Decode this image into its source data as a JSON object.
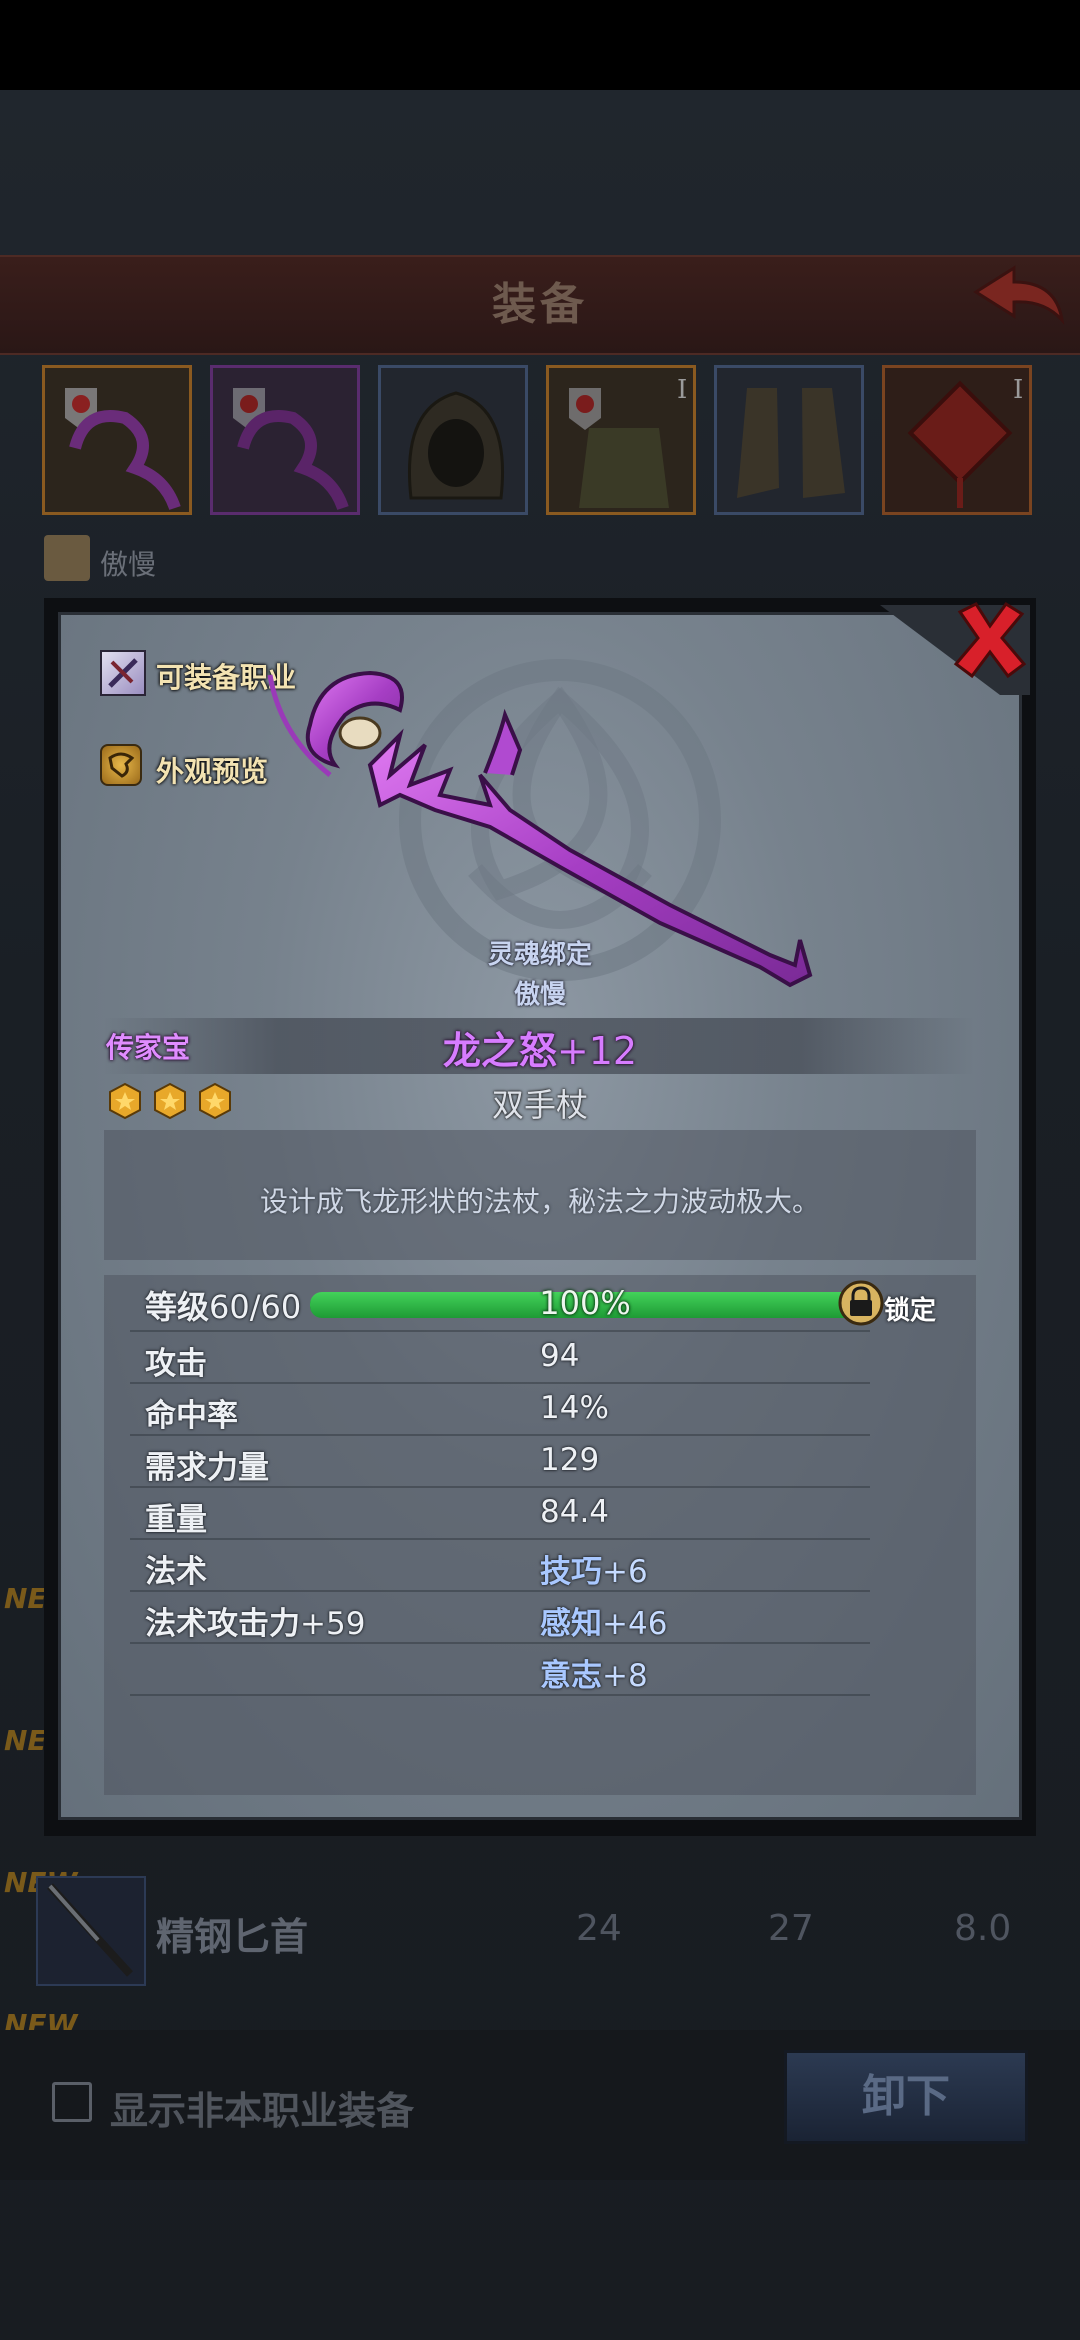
{
  "background_screen": {
    "title": "装备",
    "owner_name": "傲慢",
    "equipment_slots": [
      {
        "name": "staff",
        "quality": "gold",
        "tier": ""
      },
      {
        "name": "staff",
        "quality": "purple",
        "tier": ""
      },
      {
        "name": "hood",
        "quality": "blue",
        "tier": ""
      },
      {
        "name": "armor",
        "quality": "gold",
        "tier": "I"
      },
      {
        "name": "boots",
        "quality": "blue",
        "tier": ""
      },
      {
        "name": "charm",
        "quality": "orange",
        "tier": "I"
      }
    ],
    "new_tags": [
      "NEW",
      "NEW",
      "NEW",
      "NEW"
    ],
    "list_item": {
      "name": "精钢匕首",
      "stat1": "24",
      "stat2": "27",
      "stat3": "8.0"
    },
    "show_other_class_label": "显示非本职业装备",
    "unequip_label": "卸下"
  },
  "popup": {
    "job_button_label": "可装备职业",
    "preview_button_label": "外观预览",
    "soulbound_label": "灵魂绑定",
    "bound_owner": "傲慢",
    "rarity": "传家宝",
    "item_name": "龙之怒",
    "enhance": "+12",
    "stars": 3,
    "item_type": "双手杖",
    "description": "设计成飞龙形状的法杖，秘法之力波动极大。",
    "level_label": "等级",
    "level_value": "60/60",
    "progress_text": "100%",
    "progress": 1.0,
    "lock_label": "锁定",
    "stats": [
      {
        "label": "攻击",
        "value": "94"
      },
      {
        "label": "命中率",
        "value": "14%"
      },
      {
        "label": "需求力量",
        "value": "129"
      },
      {
        "label": "重量",
        "value": "84.4"
      }
    ],
    "magic_label": "法术",
    "magic_attack_label": "法术攻击力",
    "magic_attack_value": "+59",
    "bonus_stats": [
      {
        "label": "技巧",
        "value": "+6"
      },
      {
        "label": "感知",
        "value": "+46"
      },
      {
        "label": "意志",
        "value": "+8"
      }
    ]
  },
  "colors": {
    "rarity": "#e08cff",
    "item_name": "#d77cff",
    "bonus": "#a9c8ff",
    "progress": "#2ab545",
    "close": "#d8202a"
  }
}
